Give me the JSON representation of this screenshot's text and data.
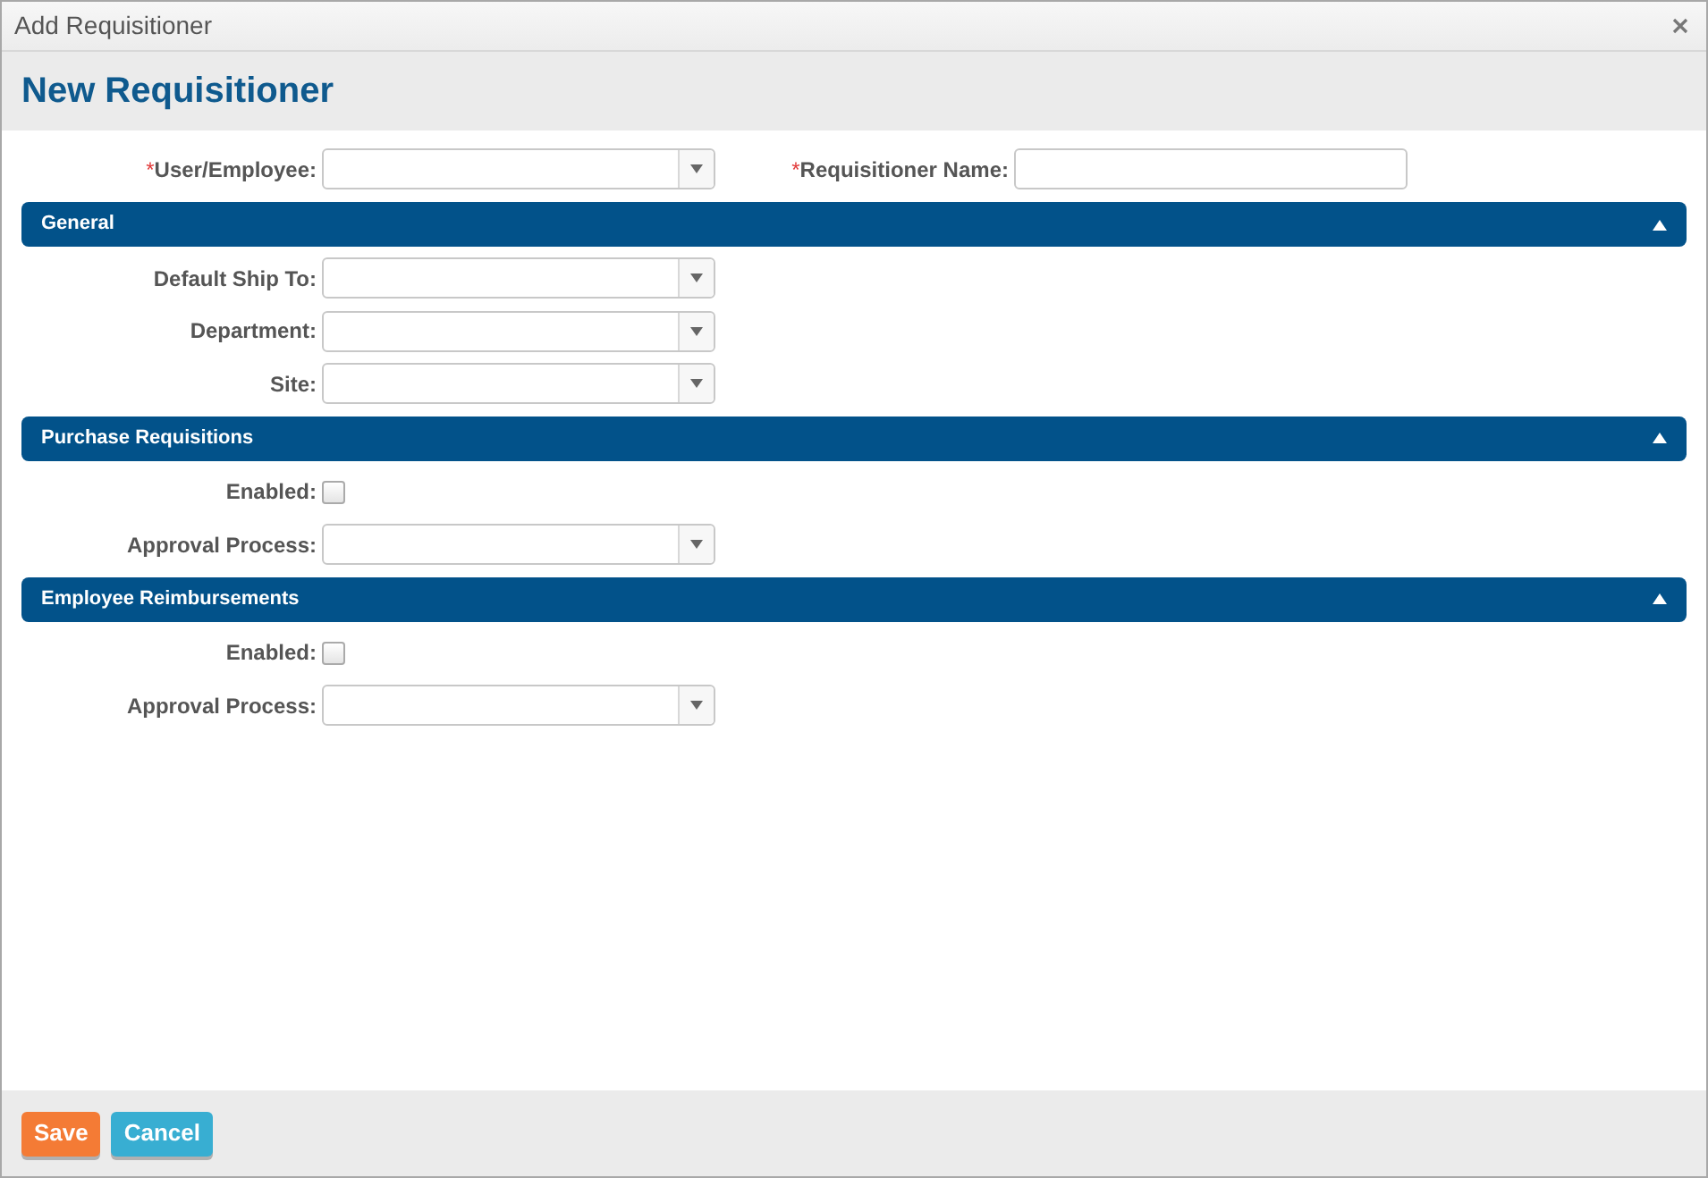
{
  "window": {
    "title": "Add Requisitioner"
  },
  "header": {
    "title": "New Requisitioner"
  },
  "top_fields": [
    {
      "label": "User/Employee:",
      "required_mark": "*",
      "kind": "dropdown"
    },
    {
      "label": "Requisitioner Name:",
      "required_mark": "*",
      "kind": "text"
    }
  ],
  "sections": [
    {
      "title": "General",
      "expanded": true,
      "fields": [
        {
          "label": "Default Ship To:",
          "kind": "dropdown"
        },
        {
          "label": "Department:",
          "kind": "dropdown"
        },
        {
          "label": "Site:",
          "kind": "dropdown"
        }
      ]
    },
    {
      "title": "Purchase Requisitions",
      "expanded": true,
      "fields": [
        {
          "label": "Enabled:",
          "kind": "checkbox",
          "checked": false
        },
        {
          "label": "Approval Process:",
          "kind": "dropdown"
        }
      ]
    },
    {
      "title": "Employee Reimbursements",
      "expanded": true,
      "fields": [
        {
          "label": "Enabled:",
          "kind": "checkbox",
          "checked": false
        },
        {
          "label": "Approval Process:",
          "kind": "dropdown"
        }
      ]
    }
  ],
  "buttons": [
    {
      "label": "Save",
      "kind": "primary"
    },
    {
      "label": "Cancel",
      "kind": "secondary"
    }
  ]
}
